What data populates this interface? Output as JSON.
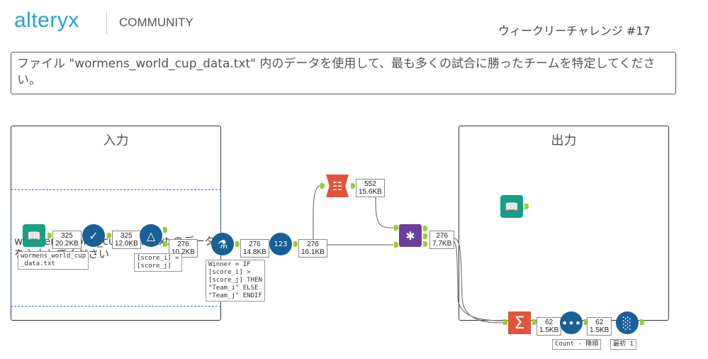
{
  "header": {
    "logo": "alteryx",
    "section": "COMMUNITY",
    "challenge": "ウィークリーチャレンジ #17"
  },
  "question": "ファイル \"wormens_world_cup_data.txt\" 内のデータを使用して、最も多くの試合に勝ったチームを特定してください。",
  "containers": {
    "input": "入力",
    "output": "出力"
  },
  "behind_text": "wormens_world_cup_data.txt のデータを入力してください",
  "tools": {
    "input": {
      "icon": "book-icon",
      "label": "wormens_world_cup\n_data.txt",
      "records": "325",
      "size": "20.2KB"
    },
    "select1": {
      "icon": "check-icon",
      "records": "325",
      "size": "12.0KB"
    },
    "filter": {
      "icon": "filter-icon",
      "label": "[score_i] =\n[score_j]",
      "records": "276",
      "size": "10.2KB"
    },
    "formula": {
      "icon": "flask-icon",
      "label": "Winner = IF\n[score_i] >\n[score_j] THEN\n\"Team_i\" ELSE\n\"Team_j\" ENDIF",
      "records": "276",
      "size": "14.8KB"
    },
    "recordid": {
      "icon": "record-id-icon",
      "records": "276",
      "size": "16.1KB"
    },
    "union": {
      "icon": "union-icon",
      "records": "552",
      "size": "15.6KB"
    },
    "join": {
      "icon": "join-icon",
      "records": "276",
      "size": "7.7KB"
    },
    "summarize": {
      "icon": "sigma-icon",
      "records": "62",
      "size": "1.5KB"
    },
    "sort": {
      "icon": "sort-icon",
      "label": "Count - 降順",
      "records": "62",
      "size": "1.5KB"
    },
    "sample": {
      "icon": "sample-icon",
      "label": "最初 1"
    },
    "browse": {
      "icon": "browse-icon"
    }
  },
  "colors": {
    "logo": "#2a9fd6",
    "blue_tool": "#1a5f96",
    "teal_tool": "#16a086",
    "orange_tool": "#e0553b",
    "purple_tool": "#6b3f99",
    "anchor": "#9acd32"
  }
}
